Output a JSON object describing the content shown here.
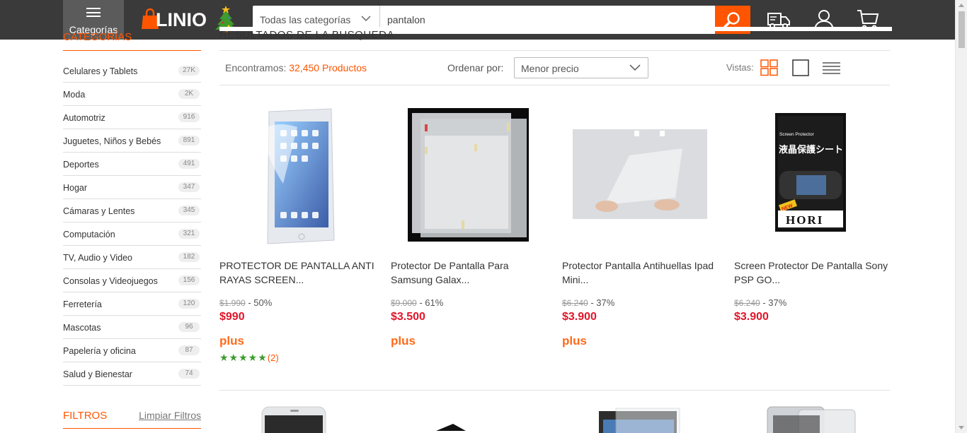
{
  "header": {
    "categories_button": "Categorías",
    "logo_text": "LINIO",
    "search": {
      "category": "Todas las categorías",
      "query": "pantalon"
    },
    "icons": [
      "shipping-truck-icon",
      "user-account-icon",
      "shopping-cart-icon"
    ]
  },
  "sidebar": {
    "heading": "CATEGORÍAS",
    "categories": [
      {
        "name": "Celulares y Tablets",
        "count": "27K"
      },
      {
        "name": "Moda",
        "count": "2K"
      },
      {
        "name": "Automotriz",
        "count": "916"
      },
      {
        "name": "Juguetes, Niños y Bebés",
        "count": "891"
      },
      {
        "name": "Deportes",
        "count": "491"
      },
      {
        "name": "Hogar",
        "count": "347"
      },
      {
        "name": "Cámaras y Lentes",
        "count": "345"
      },
      {
        "name": "Computación",
        "count": "321"
      },
      {
        "name": "TV, Audio y Video",
        "count": "182"
      },
      {
        "name": "Consolas y Videojuegos",
        "count": "156"
      },
      {
        "name": "Ferretería",
        "count": "120"
      },
      {
        "name": "Mascotas",
        "count": "96"
      },
      {
        "name": "Papelería y oficina",
        "count": "87"
      },
      {
        "name": "Salud y Bienestar",
        "count": "74"
      }
    ],
    "filters": {
      "heading": "FILTROS",
      "clear": "Limpiar Filtros"
    }
  },
  "results": {
    "title": "RESULTADOS DE LA BÚSQUEDA",
    "found_label": "Encontramos:",
    "found_value": "32,450 Productos",
    "order_label": "Ordenar por:",
    "order_value": "Menor precio",
    "views_label": "Vistas:"
  },
  "products": [
    {
      "name_line1": "PROTECTOR DE PANTALLA ANTI",
      "name_line2": "RAYAS SCREEN...",
      "old_price": "$1.990",
      "discount": "- 50%",
      "price": "$990",
      "plus": "plus",
      "rating_count": "(2)",
      "stars": 5
    },
    {
      "name_line1": "Protector De Pantalla Para",
      "name_line2": "Samsung Galax...",
      "old_price": "$9.000",
      "discount": "- 61%",
      "price": "$3.500",
      "plus": "plus"
    },
    {
      "name_line1": "Protector Pantalla Antihuellas Ipad",
      "name_line2": "Mini...",
      "old_price": "$6.240",
      "discount": "- 37%",
      "price": "$3.900",
      "plus": "plus"
    },
    {
      "name_line1": "Screen Protector De Pantalla Sony",
      "name_line2": "PSP GO...",
      "old_price": "$6.240",
      "discount": "- 37%",
      "price": "$3.900"
    }
  ],
  "image_text": {
    "hori_brand": "HORI",
    "hori_subtitle": "Screen Protector",
    "hori_jp": "液晶保護シート",
    "hori_new": "NEW"
  },
  "colors": {
    "accent": "#ff5500",
    "price": "#e0172a",
    "header": "#3a3a3a",
    "stars": "#3d9b2f"
  }
}
